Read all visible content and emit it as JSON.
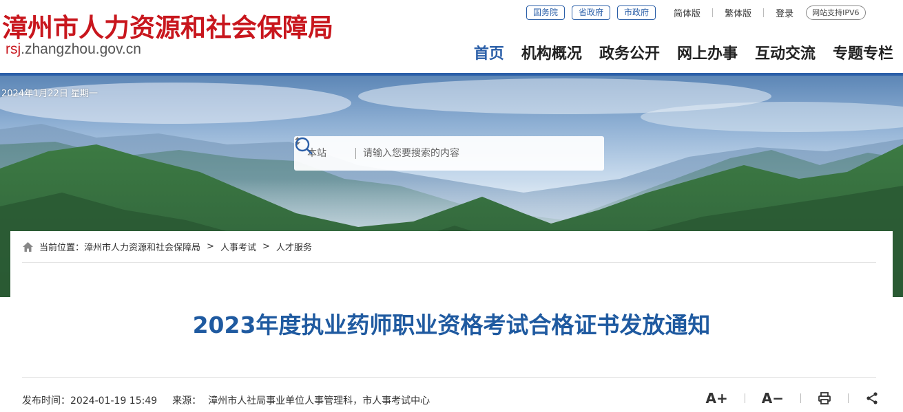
{
  "header": {
    "site_title": "漳州市人力资源和社会保障局",
    "domain_accent": "rsj",
    "domain_rest": ".zhangzhou.gov.cn",
    "top_links": {
      "gov_council": "国务院",
      "province_gov": "省政府",
      "city_gov": "市政府",
      "simplified": "简体版",
      "traditional": "繁体版",
      "login": "登录",
      "ipv6": "网站支持IPV6"
    },
    "nav": [
      "首页",
      "机构概况",
      "政务公开",
      "网上办事",
      "互动交流",
      "专题专栏"
    ]
  },
  "banner": {
    "date": "2024年1月22日 星期一",
    "search": {
      "scope": "本站",
      "placeholder": "请输入您要搜索的内容"
    }
  },
  "breadcrumb": {
    "label": "当前位置：",
    "items": [
      "漳州市人力资源和社会保障局",
      "人事考试",
      "人才服务"
    ],
    "separator": ">"
  },
  "article": {
    "title": "2023年度执业药师职业资格考试合格证书发放通知",
    "publish_label": "发布时间：",
    "publish_time": "2024-01-19 15:49",
    "source_label": "来源：",
    "source": "漳州市人社局事业单位人事管理科，市人事考试中心"
  },
  "tools": {
    "font_larger": "A+",
    "font_smaller": "A−"
  },
  "colors": {
    "brand_red": "#c8161d",
    "brand_blue": "#2b5fa8",
    "title_blue": "#1f5aa0"
  }
}
